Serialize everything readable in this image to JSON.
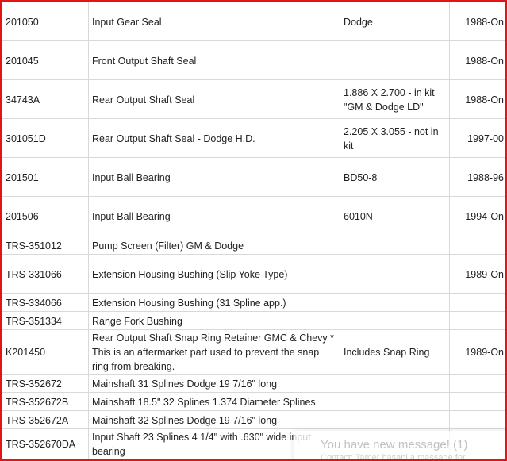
{
  "rows": [
    {
      "part": "201050",
      "description": "Input Gear Seal",
      "notes": "Dodge",
      "years": "1988-On"
    },
    {
      "part": "201045",
      "description": "Front Output Shaft Seal",
      "notes": "",
      "years": "1988-On"
    },
    {
      "part": "34743A",
      "description": "Rear Output Shaft Seal",
      "notes": "1.886 X 2.700 - in kit \"GM & Dodge LD\"",
      "years": "1988-On"
    },
    {
      "part": "301051D",
      "description": "Rear Output Shaft Seal - Dodge H.D.",
      "notes": "2.205 X 3.055 - not in kit",
      "years": "1997-00"
    },
    {
      "part": "201501",
      "description": "Input Ball Bearing",
      "notes": "BD50-8",
      "years": "1988-96"
    },
    {
      "part": "201506",
      "description": "Input Ball Bearing",
      "notes": "6010N",
      "years": "1994-On"
    },
    {
      "part": "TRS-351012",
      "description": "Pump Screen (Filter) GM & Dodge",
      "notes": "",
      "years": ""
    },
    {
      "part": "TRS-331066",
      "description": "Extension Housing Bushing (Slip Yoke Type)",
      "notes": "",
      "years": "1989-On"
    },
    {
      "part": "TRS-334066",
      "description": "Extension Housing Bushing (31 Spline app.)",
      "notes": "",
      "years": ""
    },
    {
      "part": "TRS-351334",
      "description": "Range Fork Bushing",
      "notes": "",
      "years": ""
    },
    {
      "part": "K201450",
      "description": "Rear Output Shaft Snap Ring Retainer GMC & Chevy * This is an aftermarket part used to prevent the snap ring from breaking.",
      "notes": "Includes Snap Ring",
      "years": "1989-On"
    },
    {
      "part": "TRS-352672",
      "description": "Mainshaft 31 Splines Dodge 19 7/16\" long",
      "notes": "",
      "years": ""
    },
    {
      "part": "TRS-352672B",
      "description": "Mainshaft 18.5\" 32 Splines  1.374 Diameter Splines",
      "notes": "",
      "years": ""
    },
    {
      "part": "TRS-352672A",
      "description": "Mainshaft 32 Splines Dodge 19 7/16\" long",
      "notes": "",
      "years": ""
    },
    {
      "part": "TRS-352670DA",
      "description": "Input Shaft 23 Splines 4 1/4\"  with .630\" wide input bearing",
      "notes": "",
      "years": ""
    }
  ],
  "notification": {
    "title": "You have new message! (1)",
    "subtitle": "Contact: Tamer hasanl a massage for"
  }
}
